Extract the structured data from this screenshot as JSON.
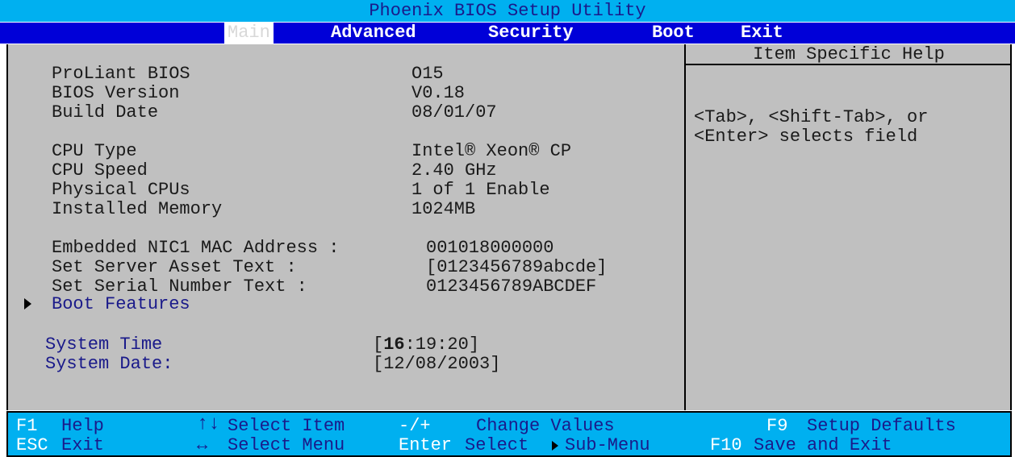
{
  "window": {
    "title": "Phoenix BIOS Setup Utility"
  },
  "menu": [
    {
      "label": "Main",
      "active": true
    },
    {
      "label": "Advanced"
    },
    {
      "label": "Security"
    },
    {
      "label": "Boot"
    },
    {
      "label": "Exit"
    }
  ],
  "main": {
    "proliant_bios": {
      "label": "ProLiant BIOS",
      "value": "O15"
    },
    "bios_version": {
      "label": "BIOS Version",
      "value": "V0.18"
    },
    "build_date": {
      "label": "Build Date",
      "value": "08/01/07"
    },
    "cpu_type": {
      "label": "CPU Type",
      "value": "Intel® Xeon® CP"
    },
    "cpu_speed": {
      "label": "CPU Speed",
      "value": "2.40 GHz"
    },
    "physical_cpus": {
      "label": "Physical CPUs",
      "value": "1 of 1 Enable"
    },
    "installed_memory": {
      "label": "Installed Memory",
      "value": "1024MB"
    },
    "nic_mac": {
      "label": "Embedded NIC1 MAC Address :",
      "value": "001018000000"
    },
    "asset_text": {
      "label": "Set Server Asset Text :",
      "value": "[0123456789abcde]"
    },
    "serial_text": {
      "label": "Set Serial Number Text :",
      "value": "0123456789ABCDEF"
    },
    "boot_features": {
      "label": "Boot Features"
    },
    "system_time": {
      "label": "System Time",
      "open": "[",
      "hour": "16",
      "rest": ":19:20]"
    },
    "system_date": {
      "label": "System Date:",
      "value": "[12/08/2003]"
    }
  },
  "help": {
    "header": "Item Specific Help",
    "line1": "<Tab>, <Shift-Tab>, or",
    "line2": "<Enter> selects field"
  },
  "footer": {
    "f1_key": "F1",
    "f1_desc": "Help",
    "updown_key": "↑↓",
    "updown_desc": "Select Item",
    "plusminus_key": "-/+",
    "plusminus_desc": "Change Values",
    "f9_key": "F9",
    "f9_desc": "Setup Defaults",
    "esc_key": "ESC",
    "esc_desc": "Exit",
    "leftright_key": "↔",
    "leftright_desc": "Select Menu",
    "enter_key": "Enter",
    "enter_desc": "Select",
    "submenu_desc": "Sub-Menu",
    "f10_key": "F10",
    "f10_desc": "Save and Exit"
  },
  "colors": {
    "title_bg": "#00b0f0",
    "menubar_bg": "#0000d8",
    "panel_bg": "#c0c0c0",
    "text_blue": "#1a1a8a"
  }
}
